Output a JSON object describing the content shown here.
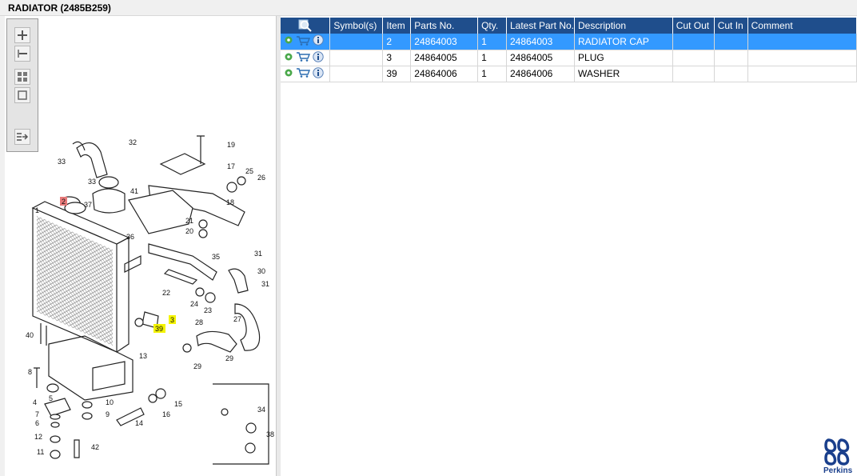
{
  "window": {
    "title": "RADIATOR (2485B259)"
  },
  "toolbar": {
    "buttons": [
      {
        "name": "zoom-in"
      },
      {
        "name": "zoom-out"
      },
      {
        "name": "fit-all"
      },
      {
        "name": "actual-size"
      },
      {
        "name": "export"
      }
    ]
  },
  "diagram": {
    "labels": [
      "32",
      "19",
      "33",
      "17",
      "25",
      "33",
      "26",
      "41",
      "2",
      "37",
      "18",
      "1",
      "21",
      "20",
      "36",
      "35",
      "31",
      "30",
      "22",
      "31",
      "24",
      "23",
      "27",
      "3",
      "28",
      "40",
      "39",
      "29",
      "29",
      "13",
      "8",
      "5",
      "10",
      "4",
      "7",
      "9",
      "15",
      "16",
      "14",
      "6",
      "34",
      "12",
      "38",
      "11",
      "42"
    ],
    "highlighted": [
      "2",
      "3",
      "39"
    ],
    "highlight_colors": {
      "2": "#e87a7a",
      "3": "#f4f400",
      "39": "#f4f400"
    }
  },
  "parts_table": {
    "columns": [
      "",
      "Symbol(s)",
      "Item",
      "Parts No.",
      "Qty.",
      "Latest Part No.",
      "Description",
      "Cut Out",
      "Cut In",
      "Comment"
    ],
    "rows": [
      {
        "symbols": "",
        "item": "2",
        "part_no": "24864003",
        "qty": "1",
        "latest": "24864003",
        "description": "RADIATOR CAP",
        "cut_out": "",
        "cut_in": "",
        "comment": "",
        "selected": true
      },
      {
        "symbols": "",
        "item": "3",
        "part_no": "24864005",
        "qty": "1",
        "latest": "24864005",
        "description": "PLUG",
        "cut_out": "",
        "cut_in": "",
        "comment": "",
        "selected": false
      },
      {
        "symbols": "",
        "item": "39",
        "part_no": "24864006",
        "qty": "1",
        "latest": "24864006",
        "description": "WASHER",
        "cut_out": "",
        "cut_in": "",
        "comment": "",
        "selected": false
      }
    ]
  },
  "brand": {
    "name": "Perkins",
    "color": "#1a3f8c"
  },
  "colors": {
    "header_bg": "#1f4e8c",
    "selected_row": "#3399ff"
  }
}
